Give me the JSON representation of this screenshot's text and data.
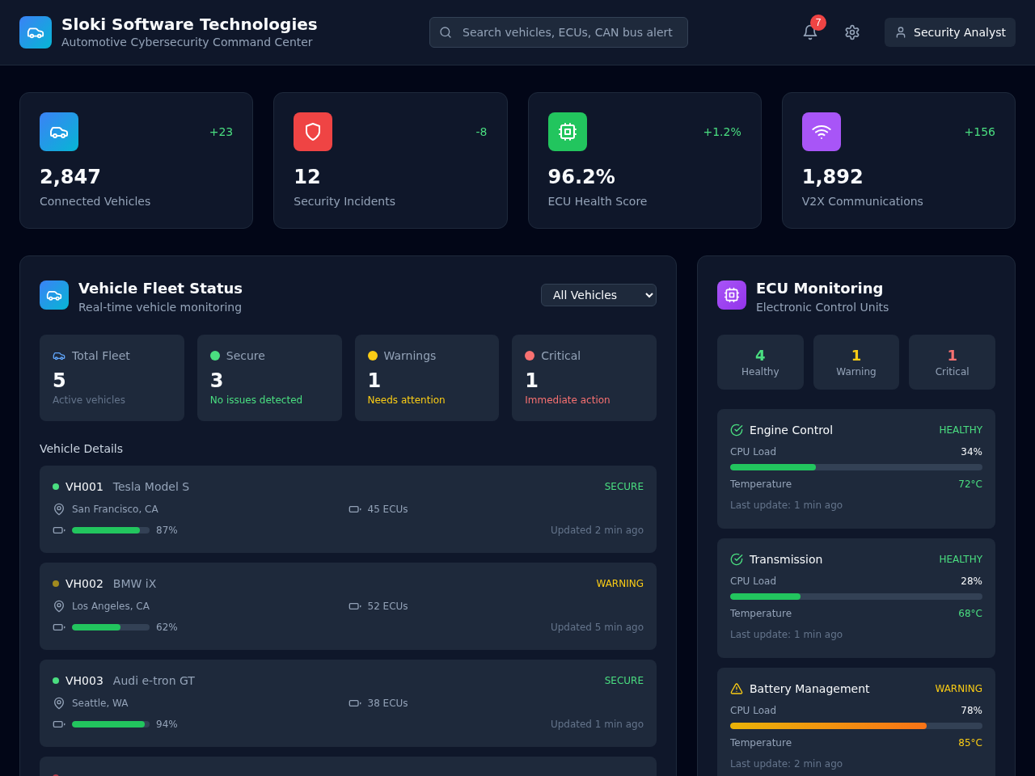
{
  "header": {
    "title": "Sloki Software Technologies",
    "subtitle": "Automotive Cybersecurity Command Center",
    "search": {
      "placeholder": "Search vehicles, ECUs, CAN bus alert"
    },
    "notifications": "7",
    "user": "Security Analyst"
  },
  "stats": [
    {
      "kind": "vehicles",
      "change": "+23",
      "value": "2,847",
      "label": "Connected Vehicles"
    },
    {
      "kind": "incidents",
      "change": "-8",
      "value": "12",
      "label": "Security Incidents"
    },
    {
      "kind": "ecu",
      "change": "+1.2%",
      "value": "96.2%",
      "label": "ECU Health Score"
    },
    {
      "kind": "v2x",
      "change": "+156",
      "value": "1,892",
      "label": "V2X Communications"
    }
  ],
  "fleet": {
    "title": "Vehicle Fleet Status",
    "subtitle": "Real-time vehicle monitoring",
    "filter": "All Vehicles",
    "summary": [
      {
        "kind": "total",
        "label": "Total Fleet",
        "value": "5",
        "note": "Active vehicles"
      },
      {
        "kind": "secure",
        "label": "Secure",
        "value": "3",
        "note": "No issues detected"
      },
      {
        "kind": "warning",
        "label": "Warnings",
        "value": "1",
        "note": "Needs attention"
      },
      {
        "kind": "critical",
        "label": "Critical",
        "value": "1",
        "note": "Immediate action"
      }
    ],
    "details_title": "Vehicle Details",
    "vehicles": [
      {
        "id": "VH001",
        "model": "Tesla Model S",
        "kind": "secure",
        "status": "SECURE",
        "location": "San Francisco, CA",
        "ecus": "45 ECUs",
        "level": 0.87,
        "battery": "87%",
        "updated": "Updated 2 min ago"
      },
      {
        "id": "VH002",
        "model": "BMW iX",
        "kind": "warning",
        "status": "WARNING",
        "location": "Los Angeles, CA",
        "ecus": "52 ECUs",
        "level": 0.62,
        "battery": "62%",
        "updated": "Updated 5 min ago"
      },
      {
        "id": "VH003",
        "model": "Audi e-tron GT",
        "kind": "secure",
        "status": "SECURE",
        "location": "Seattle, WA",
        "ecus": "38 ECUs",
        "level": 0.94,
        "battery": "94%",
        "updated": "Updated 1 min ago"
      },
      {
        "kind": "critical"
      }
    ]
  },
  "ecu": {
    "title": "ECU Monitoring",
    "subtitle": "Electronic Control Units",
    "summary": [
      {
        "kind": "healthy",
        "value": "4",
        "label": "Healthy"
      },
      {
        "kind": "warning",
        "value": "1",
        "label": "Warning"
      },
      {
        "kind": "critical",
        "value": "1",
        "label": "Critical"
      }
    ],
    "units": [
      {
        "name": "Engine Control",
        "kind": "healthy",
        "status": "HEALTHY",
        "cpu_label": "CPU Load",
        "cpu": "34%",
        "level": 0.34,
        "temp_label": "Temperature",
        "temp": "72°C",
        "updated": "Last update: 1 min ago"
      },
      {
        "name": "Transmission",
        "kind": "healthy",
        "status": "HEALTHY",
        "cpu_label": "CPU Load",
        "cpu": "28%",
        "level": 0.28,
        "temp_label": "Temperature",
        "temp": "68°C",
        "updated": "Last update: 1 min ago"
      },
      {
        "name": "Battery Management",
        "kind": "warning",
        "status": "WARNING",
        "cpu_label": "CPU Load",
        "cpu": "78%",
        "level": 0.78,
        "temp_label": "Temperature",
        "temp": "85°C",
        "updated": "Last update: 2 min ago"
      }
    ]
  }
}
